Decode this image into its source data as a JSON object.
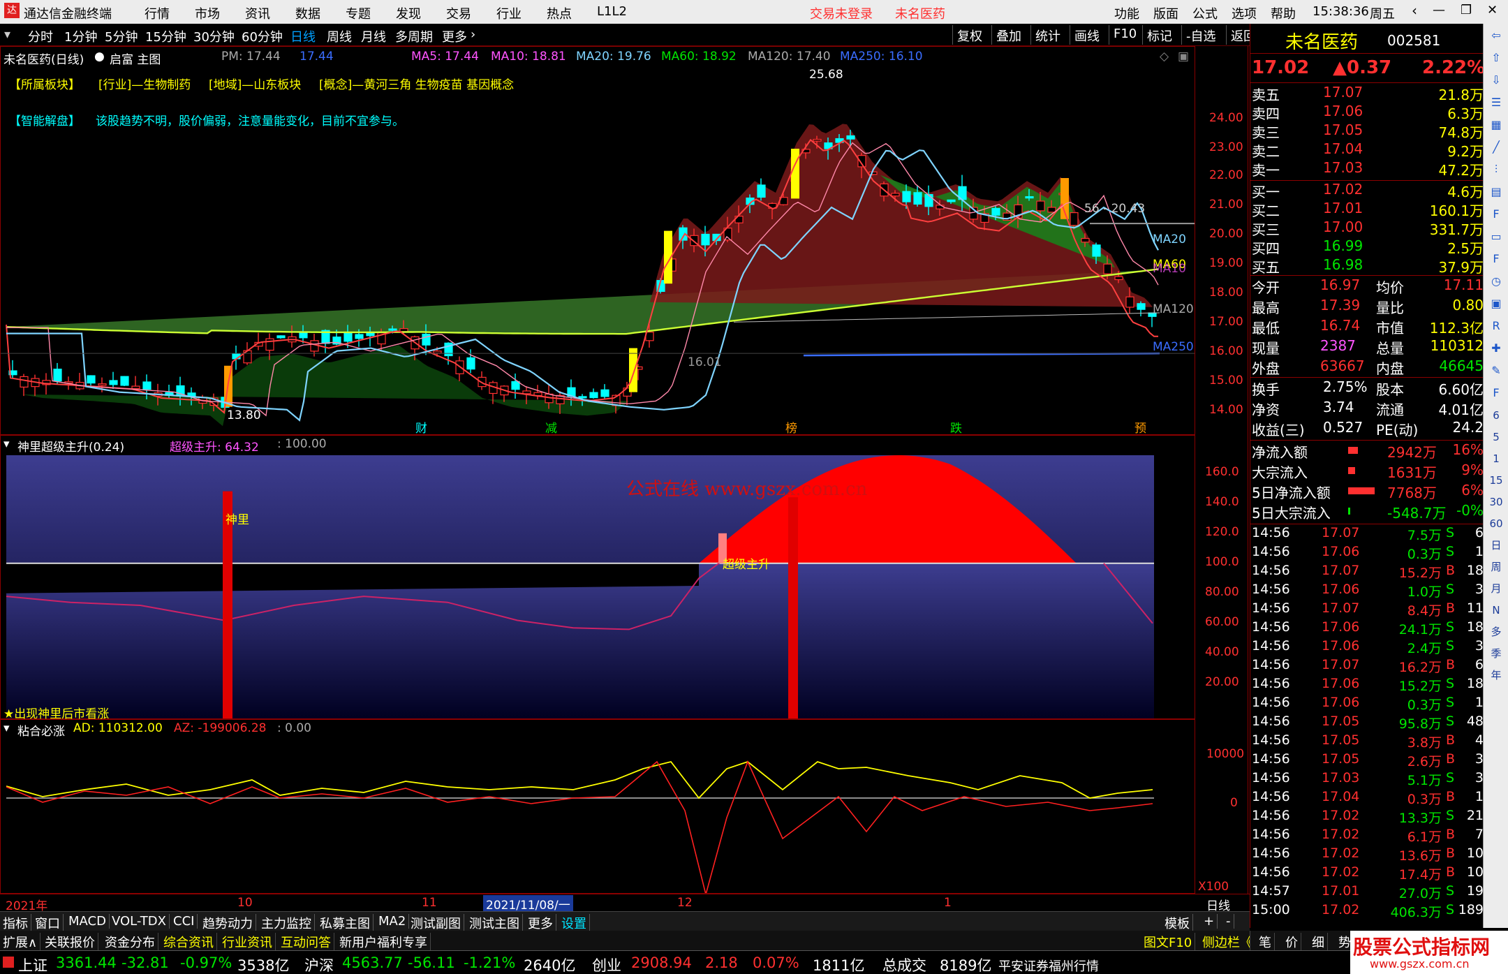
{
  "titlebar": {
    "app_title": "通达信金融终端",
    "menus": [
      "行情",
      "市场",
      "资讯",
      "数据",
      "专题",
      "发现",
      "交易",
      "行业",
      "热点",
      "L1L2"
    ],
    "login_status": "交易未登录",
    "stock_name": "未名医药",
    "right_menus": [
      "功能",
      "版面",
      "公式",
      "选项",
      "帮助"
    ],
    "time": "15:38:36",
    "weekday": "周五"
  },
  "periods": [
    "分时",
    "1分钟",
    "5分钟",
    "15分钟",
    "30分钟",
    "60分钟",
    "日线",
    "周线",
    "月线",
    "多周期",
    "更多"
  ],
  "selected_period": "日线",
  "toolbar_right": [
    "复权",
    "叠加",
    "统计",
    "画线",
    "F10",
    "标记",
    "-自选",
    "返回"
  ],
  "main_chart": {
    "header": "未名医药(日线)",
    "qifu": "启富 主图",
    "pm": "PM: 17.44",
    "pm2": "17.44",
    "ma5": "MA5: 17.44",
    "ma10": "MA10: 18.81",
    "ma20": "MA20: 19.76",
    "ma60": "MA60: 18.92",
    "ma120": "MA120: 17.40",
    "ma250": "MA250: 16.10",
    "sectors_label": "【所属板块】",
    "sector_industry": "[行业]—生物制药",
    "sector_region": "[地域]—山东板块",
    "sector_concept": "[概念]—黄河三角 生物疫苗 基因概念",
    "smart_label": "【智能解盘】",
    "smart_text": "该股趋势不明，股价偏弱，注意量能变化，目前不宜参与。",
    "high_label": "25.68",
    "low_label": "13.80",
    "mid_label": "56 - 20.43",
    "mid2_label": "16.01",
    "ma_line_labels": [
      "MA20",
      "MA60",
      "MA10",
      "MA120",
      "MA250"
    ],
    "markers": [
      "财",
      "减",
      "榜",
      "跌",
      "预"
    ],
    "y_ticks": [
      "24.00",
      "23.00",
      "22.00",
      "21.00",
      "20.00",
      "19.00",
      "18.00",
      "17.00",
      "16.00",
      "15.00",
      "14.00"
    ]
  },
  "indicator1": {
    "header": "神里超级主升(0.24)",
    "value1": "超级主升: 64.32",
    "value2": ": 100.00",
    "watermark": "公式在线  www.gszx.com.cn",
    "label_shenli": "神里",
    "label_zhusheng": "超级主升",
    "footer": "★出现神里后市看涨",
    "y_ticks": [
      "160.0",
      "140.0",
      "120.0",
      "100.0",
      "80.00",
      "60.00",
      "40.00",
      "20.00"
    ]
  },
  "indicator2": {
    "header": "粘合必涨",
    "ad": "AD: 110312.00",
    "az": "AZ: -199006.28",
    "zero": ": 0.00",
    "y_ticks": [
      "10000",
      "0"
    ],
    "x100": "X100"
  },
  "xaxis": {
    "labels": [
      "2021年",
      "10",
      "11",
      "2021/11/08/一",
      "12",
      "1"
    ],
    "mode": "日线"
  },
  "quote": {
    "name": "未名医药",
    "code": "002581",
    "price": "17.02",
    "change": "▲0.37",
    "pct": "2.22%",
    "asks": [
      {
        "label": "卖五",
        "price": "17.07",
        "vol": "21.8万"
      },
      {
        "label": "卖四",
        "price": "17.06",
        "vol": "6.3万"
      },
      {
        "label": "卖三",
        "price": "17.05",
        "vol": "74.8万"
      },
      {
        "label": "卖二",
        "price": "17.04",
        "vol": "9.2万"
      },
      {
        "label": "卖一",
        "price": "17.03",
        "vol": "47.2万"
      }
    ],
    "bids": [
      {
        "label": "买一",
        "price": "17.02",
        "vol": "4.6万"
      },
      {
        "label": "买二",
        "price": "17.01",
        "vol": "160.1万"
      },
      {
        "label": "买三",
        "price": "17.00",
        "vol": "331.7万"
      },
      {
        "label": "买四",
        "price": "16.99",
        "vol": "2.5万"
      },
      {
        "label": "买五",
        "price": "16.98",
        "vol": "37.9万"
      }
    ],
    "stats": [
      {
        "k1": "今开",
        "v1": "16.97",
        "k2": "均价",
        "v2": "17.11"
      },
      {
        "k1": "最高",
        "v1": "17.39",
        "k2": "量比",
        "v2": "0.80"
      },
      {
        "k1": "最低",
        "v1": "16.74",
        "k2": "市值",
        "v2": "112.3亿"
      },
      {
        "k1": "现量",
        "v1": "2387",
        "k2": "总量",
        "v2": "110312"
      },
      {
        "k1": "外盘",
        "v1": "63667",
        "k2": "内盘",
        "v2": "46645"
      }
    ],
    "stats2": [
      {
        "k1": "换手",
        "v1": "2.75%",
        "k2": "股本",
        "v2": "6.60亿"
      },
      {
        "k1": "净资",
        "v1": "3.74",
        "k2": "流通",
        "v2": "4.01亿"
      },
      {
        "k1": "收益(三)",
        "v1": "0.527",
        "k2": "PE(动)",
        "v2": "24.2"
      }
    ],
    "flows": [
      {
        "k": "净流入额",
        "v": "2942万",
        "p": "16%"
      },
      {
        "k": "大宗流入",
        "v": "1631万",
        "p": "9%"
      },
      {
        "k": "5日净流入额",
        "v": "7768万",
        "p": "6%"
      },
      {
        "k": "5日大宗流入",
        "v": "-548.7万",
        "p": "-0%"
      }
    ],
    "ticks": [
      [
        "14:56",
        "17.07",
        "7.5万",
        "S",
        "6"
      ],
      [
        "14:56",
        "17.06",
        "0.3万",
        "S",
        "1"
      ],
      [
        "14:56",
        "17.07",
        "15.2万",
        "B",
        "18"
      ],
      [
        "14:56",
        "17.06",
        "1.0万",
        "S",
        "3"
      ],
      [
        "14:56",
        "17.07",
        "8.4万",
        "B",
        "11"
      ],
      [
        "14:56",
        "17.06",
        "24.1万",
        "S",
        "18"
      ],
      [
        "14:56",
        "17.06",
        "2.4万",
        "S",
        "3"
      ],
      [
        "14:56",
        "17.07",
        "16.2万",
        "B",
        "6"
      ],
      [
        "14:56",
        "17.06",
        "15.2万",
        "S",
        "18"
      ],
      [
        "14:56",
        "17.06",
        "0.3万",
        "S",
        "1"
      ],
      [
        "14:56",
        "17.05",
        "95.8万",
        "S",
        "48"
      ],
      [
        "14:56",
        "17.05",
        "3.8万",
        "B",
        "4"
      ],
      [
        "14:56",
        "17.05",
        "2.6万",
        "B",
        "3"
      ],
      [
        "14:56",
        "17.03",
        "5.1万",
        "S",
        "3"
      ],
      [
        "14:56",
        "17.04",
        "0.3万",
        "B",
        "1"
      ],
      [
        "14:56",
        "17.02",
        "13.3万",
        "S",
        "21"
      ],
      [
        "14:56",
        "17.02",
        "6.1万",
        "B",
        "7"
      ],
      [
        "14:56",
        "17.02",
        "13.6万",
        "B",
        "10"
      ],
      [
        "14:56",
        "17.02",
        "17.4万",
        "B",
        "10"
      ],
      [
        "14:57",
        "17.01",
        "27.0万",
        "S",
        "19"
      ],
      [
        "15:00",
        "17.02",
        "406.3万",
        "S",
        "189"
      ]
    ]
  },
  "bottom_tabs": [
    "指标",
    "窗口",
    "MACD",
    "VOL-TDX",
    "CCI",
    "趋势动力",
    "主力监控",
    "私募主图",
    "MA2",
    "测试副图",
    "测试主图",
    "更多",
    "设置"
  ],
  "bottom_tabs_selected": "设置",
  "bottom_right": [
    "模板",
    "+",
    "-"
  ],
  "tabs2": [
    "扩展∧",
    "关联报价",
    "资金分布",
    "综合资讯",
    "行业资讯",
    "互动问答",
    "新用户福利专享"
  ],
  "tabs2_right": [
    "图文F10",
    "侧边栏《",
    "笔",
    "价",
    "细",
    "势"
  ],
  "logo_text": "股票公式指标网",
  "logo_url": "www.gszx.com.cn",
  "status": {
    "sh_label": "上证",
    "sh_val": "3361.44",
    "sh_chg": "-32.81",
    "sh_pct": "-0.97%",
    "sh_amt": "3538亿",
    "hs_label": "沪深",
    "hs_val": "4563.77",
    "hs_chg": "-56.11",
    "hs_pct": "-1.21%",
    "hs_amt": "2640亿",
    "cy_label": "创业",
    "cy_val": "2908.94",
    "cy_chg": "2.18",
    "cy_pct": "0.07%",
    "cy_amt": "1811亿",
    "total_label": "总成交",
    "total_val": "8189亿",
    "broker": "平安证券福州行情"
  },
  "side_icons": [
    "back-icon",
    "up-icon",
    "down-icon",
    "list-icon",
    "grid-icon",
    "line-icon",
    "kline-icon",
    "table-icon",
    "f10-icon",
    "doc-icon",
    "f2-icon",
    "clock-icon",
    "chart-icon",
    "rsi-icon",
    "cross-icon",
    "pen-icon",
    "fs-icon"
  ],
  "side_periods": [
    "6",
    "5",
    "1",
    "15",
    "30",
    "60",
    "日",
    "周",
    "月",
    "N",
    "多",
    "季",
    "年"
  ],
  "colors": {
    "up": "#ff3030",
    "down": "#00ffff",
    "ma5": "#ffffff",
    "ma10": "#ffff00",
    "ma20": "#7fd4ff",
    "ma60": "#00e600",
    "ma120": "#aaaaaa",
    "ma250": "#3a6dff",
    "panel_border": "#8b0000"
  }
}
